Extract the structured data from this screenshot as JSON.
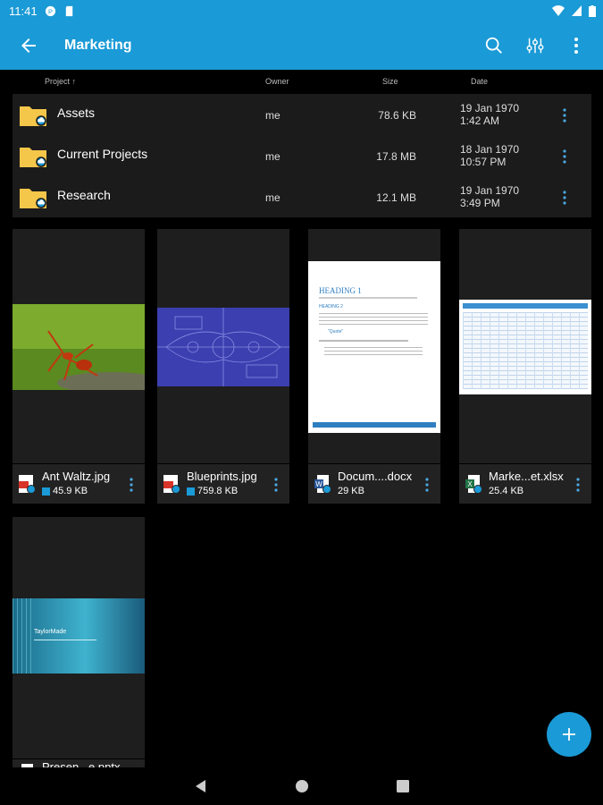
{
  "status": {
    "time": "11:41"
  },
  "appbar": {
    "title": "Marketing",
    "icons": [
      "back-arrow-icon",
      "search-icon",
      "sliders-icon",
      "more-vert-icon"
    ]
  },
  "columns": {
    "project": "Project ↑",
    "owner": "Owner",
    "size": "Size",
    "date": "Date"
  },
  "folders": [
    {
      "name": "Assets",
      "owner": "me",
      "size": "78.6 KB",
      "date": "19 Jan 1970",
      "time": "1:42 AM"
    },
    {
      "name": "Current Projects",
      "owner": "me",
      "size": "17.8 MB",
      "date": "18 Jan 1970",
      "time": "10:57 PM"
    },
    {
      "name": "Research",
      "owner": "me",
      "size": "12.1 MB",
      "date": "19 Jan 1970",
      "time": "3:49 PM"
    }
  ],
  "files": [
    {
      "name": "Ant Waltz.jpg",
      "size": "45.9 KB",
      "type": "image",
      "synced": true
    },
    {
      "name": "Blueprints.jpg",
      "size": "759.8 KB",
      "type": "image",
      "synced": true
    },
    {
      "name": "Docum....docx",
      "size": "29 KB",
      "type": "word",
      "synced": false
    },
    {
      "name": "Marke...et.xlsx",
      "size": "25.4 KB",
      "type": "excel",
      "synced": false
    },
    {
      "name": "Presen...e.pptx",
      "size": "",
      "type": "powerpoint",
      "synced": false
    }
  ],
  "doc_preview": {
    "heading": "HEADING 1",
    "subheading": "HEADING 2",
    "quote": "\"Quote\""
  },
  "ppt_preview": {
    "title": "TaylorMade"
  },
  "colors": {
    "accent": "#1a9ad6",
    "folder": "#f4c64a",
    "background": "#000000",
    "tile": "#1e1e1e"
  }
}
